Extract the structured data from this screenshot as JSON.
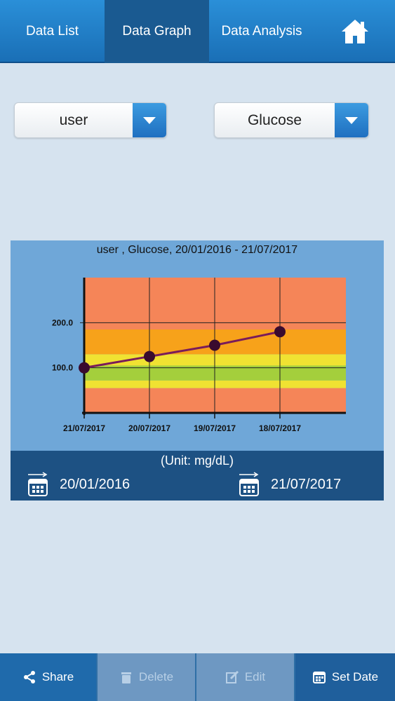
{
  "tabs": [
    {
      "label": "Data List"
    },
    {
      "label": "Data Graph"
    },
    {
      "label": "Data Analysis"
    }
  ],
  "dropdowns": {
    "user": {
      "value": "user"
    },
    "measure": {
      "value": "Glucose"
    }
  },
  "chart_data": {
    "type": "line",
    "title": "user , Glucose, 20/01/2016 - 21/07/2017",
    "x": [
      "21/07/2017",
      "20/07/2017",
      "19/07/2017",
      "18/07/2017"
    ],
    "series": [
      {
        "values": [
          100,
          125,
          150,
          180
        ]
      }
    ],
    "yticks": [
      "100.0",
      "200.0"
    ],
    "ylim": [
      0,
      300
    ],
    "bands": [
      {
        "from": 0,
        "to": 55,
        "color": "#f58558"
      },
      {
        "from": 55,
        "to": 72,
        "color": "#f0e232"
      },
      {
        "from": 72,
        "to": 105,
        "color": "#a4cf3c"
      },
      {
        "from": 105,
        "to": 130,
        "color": "#f0e232"
      },
      {
        "from": 130,
        "to": 185,
        "color": "#f7a21a"
      },
      {
        "from": 185,
        "to": 300,
        "color": "#f58558"
      }
    ],
    "line_color": "#7a1c5a",
    "point_color": "#3a0b2e",
    "grid": true
  },
  "unit_label": "(Unit: mg/dL)",
  "dates": {
    "start": "20/01/2016",
    "end": "21/07/2017"
  },
  "bottom": {
    "share": "Share",
    "delete": "Delete",
    "edit": "Edit",
    "set_date": "Set Date"
  }
}
